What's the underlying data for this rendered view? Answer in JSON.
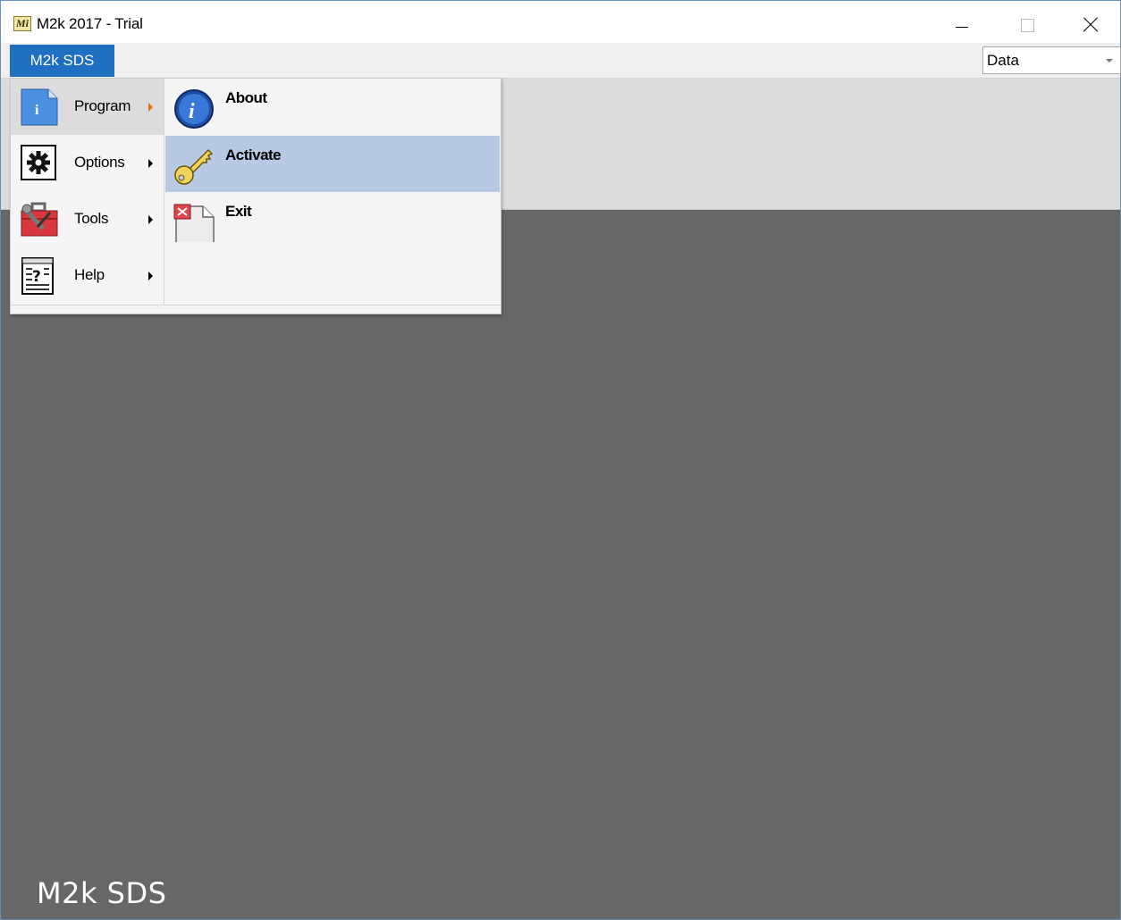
{
  "window": {
    "title": "M2k 2017 - Trial",
    "app_icon_text": "Mi"
  },
  "tabs": {
    "app_tab_label": "M2k SDS",
    "data_combo_value": "Data"
  },
  "app_menu": {
    "left_items": [
      {
        "label": "Program",
        "icon": "program-info-icon",
        "active": true
      },
      {
        "label": "Options",
        "icon": "gear-icon",
        "active": false
      },
      {
        "label": "Tools",
        "icon": "toolbox-icon",
        "active": false
      },
      {
        "label": "Help",
        "icon": "help-document-icon",
        "active": false
      }
    ],
    "right_items": [
      {
        "label": "About",
        "icon": "info-icon",
        "hovered": false
      },
      {
        "label": "Activate",
        "icon": "key-icon",
        "hovered": true
      },
      {
        "label": "Exit",
        "icon": "exit-icon",
        "hovered": false
      }
    ]
  },
  "footer": {
    "watermark": "M2k SDS"
  },
  "colors": {
    "accent_tab": "#1f6fc2",
    "workspace": "#666769",
    "menu_hover": "#b8c9e3",
    "submenu_arrow_active": "#e86e0a"
  }
}
